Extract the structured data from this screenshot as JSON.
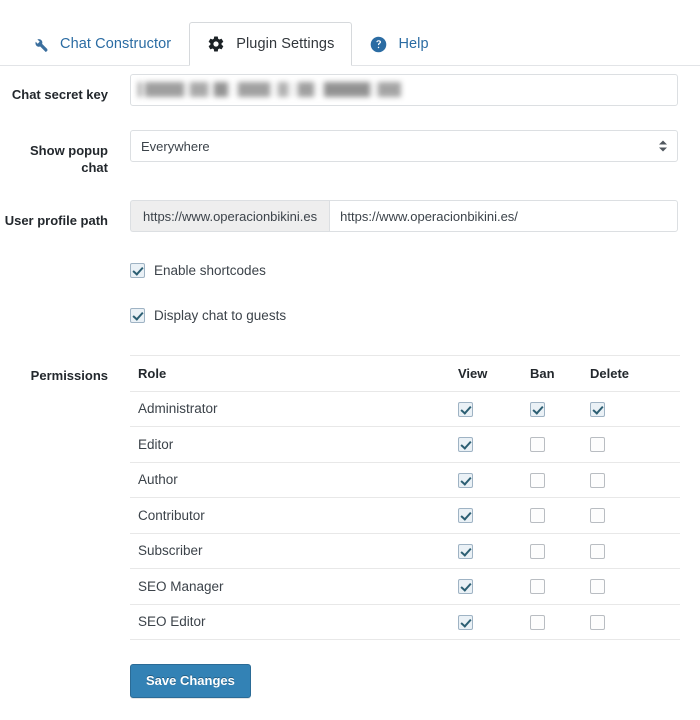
{
  "tabs": [
    {
      "label": "Chat Constructor",
      "icon": "wrench-icon",
      "active": false
    },
    {
      "label": "Plugin Settings",
      "icon": "gear-icon",
      "active": true
    },
    {
      "label": "Help",
      "icon": "help-circle-icon",
      "active": false
    }
  ],
  "form": {
    "secret_key": {
      "label": "Chat secret key",
      "value": "",
      "placeholder": "",
      "redacted": true
    },
    "popup_chat": {
      "label": "Show popup chat",
      "selected": "Everywhere"
    },
    "profile_path": {
      "label": "User profile path",
      "prefix": "https://www.operacionbikini.es",
      "value": "https://www.operacionbikini.es/",
      "placeholder": ""
    },
    "toggles": [
      {
        "label": "Enable shortcodes",
        "checked": true
      },
      {
        "label": "Display chat to guests",
        "checked": true
      }
    ]
  },
  "permissions": {
    "label": "Permissions",
    "columns": [
      "Role",
      "View",
      "Ban",
      "Delete"
    ],
    "rows": [
      {
        "role": "Administrator",
        "view": true,
        "ban": true,
        "delete": true
      },
      {
        "role": "Editor",
        "view": true,
        "ban": false,
        "delete": false
      },
      {
        "role": "Author",
        "view": true,
        "ban": false,
        "delete": false
      },
      {
        "role": "Contributor",
        "view": true,
        "ban": false,
        "delete": false
      },
      {
        "role": "Subscriber",
        "view": true,
        "ban": false,
        "delete": false
      },
      {
        "role": "SEO Manager",
        "view": true,
        "ban": false,
        "delete": false
      },
      {
        "role": "SEO Editor",
        "view": true,
        "ban": false,
        "delete": false
      }
    ]
  },
  "actions": {
    "save_label": "Save Changes"
  },
  "colors": {
    "link": "#2b6ca3",
    "button": "#3382b5",
    "checkbox_fill": "#eaf1f6",
    "checkmark": "#2c5f73",
    "border": "#e2e4e7"
  }
}
